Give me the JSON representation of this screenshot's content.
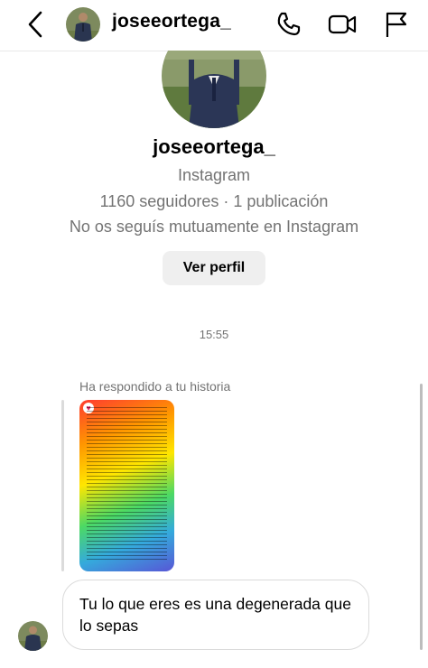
{
  "header": {
    "username": "joseeortega_",
    "icons": [
      "back-chevron-icon",
      "avatar",
      "phone-icon",
      "video-camera-icon",
      "flag-icon"
    ]
  },
  "profile": {
    "username": "joseeortega_",
    "platform": "Instagram",
    "stats": "1160 seguidores · 1 publicación",
    "mutual": "No os seguís mutuamente en Instagram",
    "view_profile_label": "Ver perfil"
  },
  "chat": {
    "timestamp": "15:55",
    "reply_label": "Ha respondido a tu historia",
    "message": "Tu lo que eres es una degenerada que lo sepas"
  },
  "colors": {
    "background": "#ffffff",
    "muted_text": "#737373",
    "button_bg": "#efefef",
    "bubble_border": "#dbdbdb"
  }
}
